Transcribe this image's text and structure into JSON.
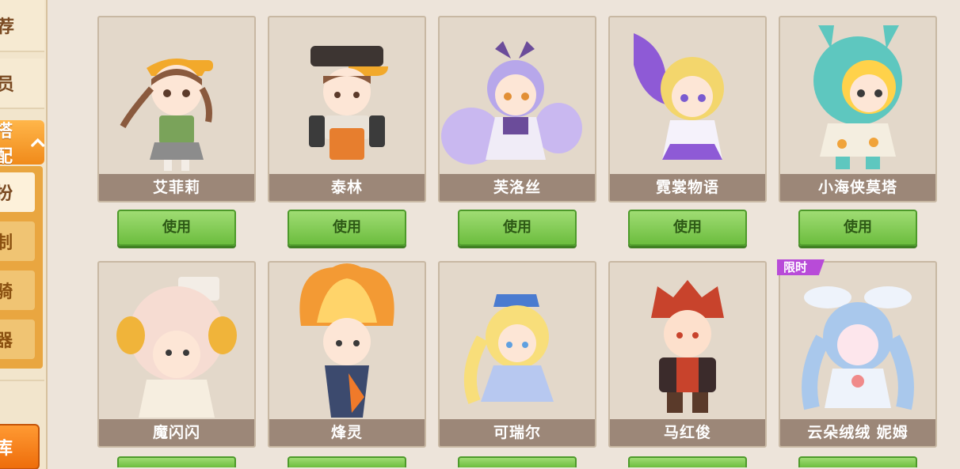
{
  "sidebar": {
    "items": [
      {
        "label": "荐"
      },
      {
        "label": "员"
      }
    ],
    "active_label": "搭配",
    "sub_items": [
      {
        "label": "扮"
      },
      {
        "label": "制"
      },
      {
        "label": "骑"
      },
      {
        "label": "器"
      }
    ],
    "bottom_button_label": "库"
  },
  "buttons": {
    "use_label": "使用"
  },
  "badges": {
    "limited": "限时"
  },
  "cards": [
    {
      "name": "艾菲莉"
    },
    {
      "name": "泰林"
    },
    {
      "name": "芙洛丝"
    },
    {
      "name": "霓裳物语"
    },
    {
      "name": "小海侠莫塔"
    },
    {
      "name": "魔闪闪"
    },
    {
      "name": "烽灵"
    },
    {
      "name": "可瑞尔"
    },
    {
      "name": "马红俊"
    },
    {
      "name": "云朵绒绒 妮姆"
    }
  ],
  "colors": {
    "sidebar_active": "#f08a1a",
    "use_button": "#6cbd3e",
    "name_bar": "#9c8778",
    "limited_badge": "#b84bd8"
  }
}
